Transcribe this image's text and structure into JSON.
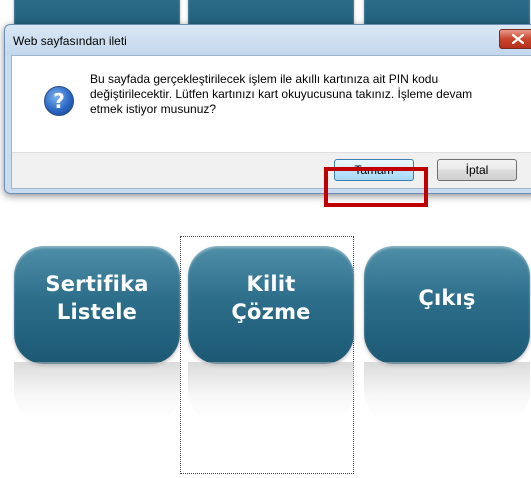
{
  "dialog": {
    "title": "Web sayfasından ileti",
    "message": "Bu sayfada gerçekleştirilecek işlem ile akıllı kartınıza ait PIN kodu\ndeğiştirilecektir. Lütfen kartınızı kart okuyucusuna takınız. İşleme devam\netmek istiyor musunuz?",
    "ok_label": "Tamam",
    "cancel_label": "İptal",
    "icon": "question-icon",
    "icon_glyph": "?"
  },
  "tiles": [
    {
      "label": "Sertifika\nListele"
    },
    {
      "label": "Kilit\nÇözme"
    },
    {
      "label": "Çıkış"
    }
  ],
  "colors": {
    "tile": "#2d6e8b",
    "highlight": "#c00000",
    "close_button": "#c9452c"
  }
}
